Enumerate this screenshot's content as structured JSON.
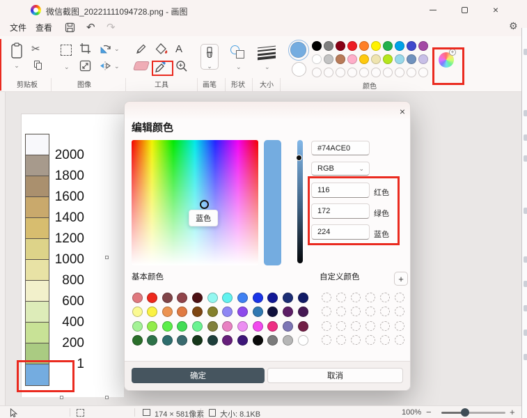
{
  "window": {
    "title": "微信截图_20221111094728.png - 画图"
  },
  "menu": {
    "file": "文件",
    "view": "查看"
  },
  "icons": {
    "cut": "✂",
    "gear": "⚙",
    "chevron_down": "⌄",
    "close": "×",
    "minus": "−",
    "plus": "+",
    "undo": "↶",
    "redo": "↷",
    "text_tool": "A"
  },
  "ribbon": {
    "groups": {
      "clipboard": "剪贴板",
      "image": "图像",
      "tools": "工具",
      "brushes": "画笔",
      "shapes": "形状",
      "size": "大小",
      "colors": "颜色"
    },
    "color1": "#74ACE0",
    "color2": "#FFFFFF",
    "palette_row1": [
      "#000000",
      "#7f7f7f",
      "#880015",
      "#ed1c24",
      "#ff7f27",
      "#fff200",
      "#22b14c",
      "#00a2e8",
      "#3f48cc",
      "#a349a4"
    ],
    "palette_row2": [
      "#ffffff",
      "#c3c3c3",
      "#b97a57",
      "#ffaec9",
      "#ffc90e",
      "#efe4b0",
      "#b5e61d",
      "#99d9ea",
      "#7092be",
      "#c8bfe7"
    ],
    "palette_empty_count": 10
  },
  "canvas_image": {
    "legend_labels": [
      "2000",
      "1800",
      "1600",
      "1400",
      "1200",
      "1000",
      "800",
      "600",
      "400",
      "200",
      "1"
    ],
    "legend_swatches": [
      "#f8f8fb",
      "#a79a8c",
      "#aa906e",
      "#c9a96c",
      "#d7bd6f",
      "#ddd389",
      "#e8e2a5",
      "#f2f0cb",
      "#ddecb9",
      "#c8e296",
      "#aacb82",
      "#74ace0"
    ]
  },
  "dialog": {
    "title": "编辑颜色",
    "tooltip": "蓝色",
    "hex_value": "#74ACE0",
    "mode": "RGB",
    "channels": [
      {
        "value": "116",
        "label": "红色"
      },
      {
        "value": "172",
        "label": "绿色"
      },
      {
        "value": "224",
        "label": "蓝色"
      }
    ],
    "basic_colors_label": "基本颜色",
    "custom_colors_label": "自定义颜色",
    "ok_label": "确定",
    "cancel_label": "取消",
    "basic_colors": [
      [
        "#e0787e",
        "#ee281c",
        "#804448",
        "#90434a",
        "#4c1013",
        "#93f7f0",
        "#61f2ef",
        "#3f80f2",
        "#1a35e8",
        "#111795",
        "#1c2d74",
        "#111a66"
      ],
      [
        "#fbfa92",
        "#fbf243",
        "#ec9351",
        "#e07a42",
        "#7e4612",
        "#85802b",
        "#8e86f4",
        "#8d4aec",
        "#3179b2",
        "#10103c",
        "#5d1e66",
        "#451853"
      ],
      [
        "#a3f295",
        "#92ec4a",
        "#5bee49",
        "#42dc55",
        "#6af391",
        "#81803b",
        "#e881c2",
        "#ec8ef2",
        "#f14aee",
        "#ee2e83",
        "#7d76b5",
        "#721e46"
      ],
      [
        "#2a6e2a",
        "#2d7148",
        "#2e6d6d",
        "#3a6a6e",
        "#153619",
        "#1e3e3a",
        "#661e7a",
        "#3d1678",
        "#0a0a0a",
        "#7b7b7b",
        "#b6b6b6",
        "#ffffff"
      ]
    ],
    "custom_rows": 4,
    "custom_cols": 6
  },
  "statusbar": {
    "canvas_size": "174 × 581像素",
    "file_size": "大小: 8.1KB",
    "zoom_level": "100%"
  },
  "annotation_color": "#ea2a1f"
}
